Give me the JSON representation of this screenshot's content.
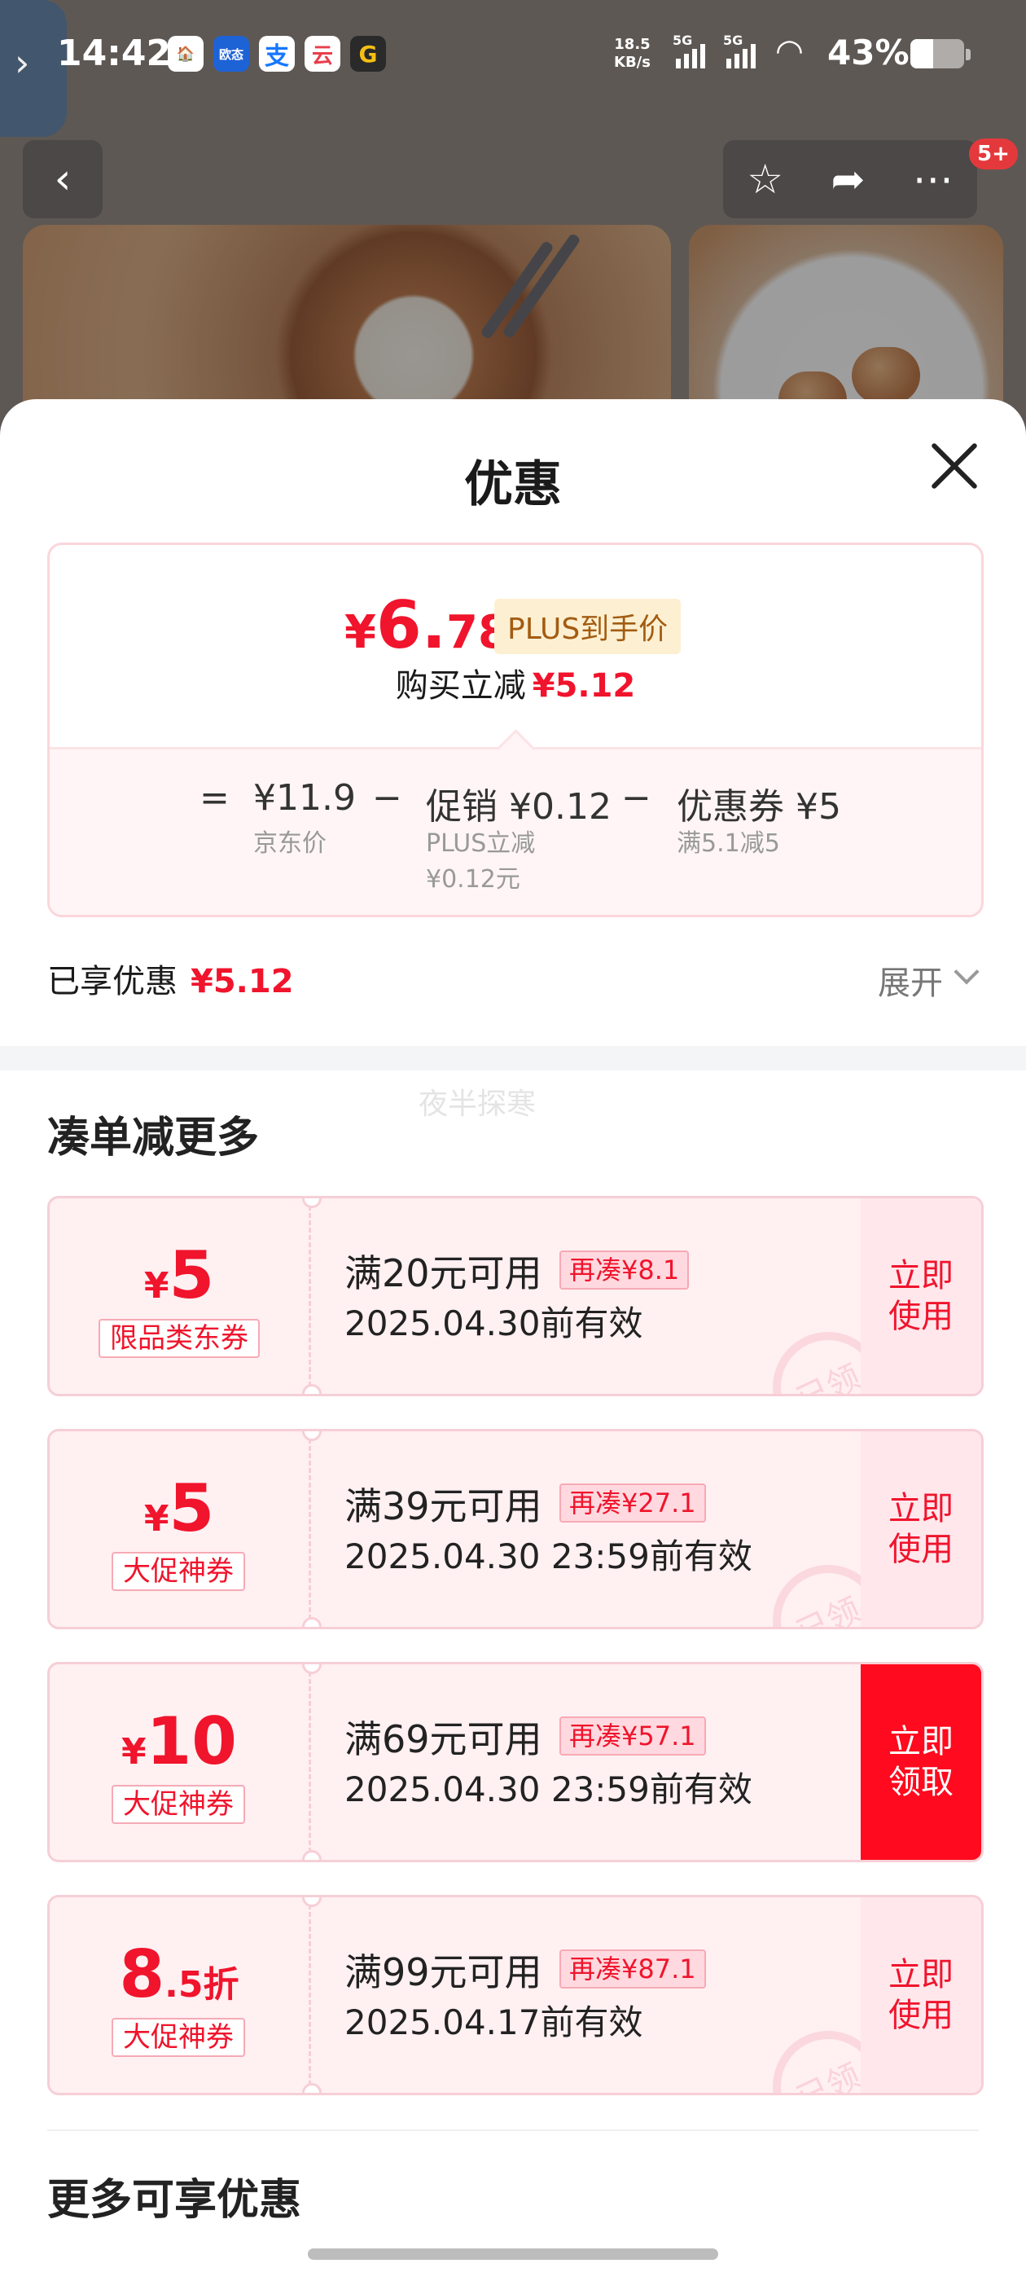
{
  "status_bar": {
    "time": "14:42",
    "app_icons": [
      {
        "label": "🏠",
        "color": "#3aa85a"
      },
      {
        "label": "欧态",
        "color": "#1e63d6"
      },
      {
        "label": "支",
        "color": "#1677ff"
      },
      {
        "label": "云",
        "color": "#e83e4b"
      },
      {
        "label": "G",
        "color": "#d9261c"
      }
    ],
    "net_speed_value": "18.5",
    "net_speed_unit": "KB/s",
    "signal1_label": "5G",
    "signal2_label": "5G",
    "battery": "43%",
    "battery_level": 0.43
  },
  "top_nav": {
    "badge": "5+"
  },
  "sheet": {
    "title": "优惠",
    "price_card": {
      "final_price_yen": "¥",
      "final_price_int": "6.",
      "final_price_dec": "78",
      "plus_tag": "PLUS到手价",
      "instant_label": "购买立减",
      "instant_amount": "¥5.12",
      "calc": {
        "equals": "=",
        "jd_price": "¥11.9",
        "jd_price_label": "京东价",
        "minus1": "−",
        "promo": "促销 ¥0.12",
        "promo_sub1": "PLUS立减",
        "promo_sub2": "¥0.12元",
        "minus2": "−",
        "coupon": "优惠券 ¥5",
        "coupon_sub": "满5.1减5"
      }
    },
    "enjoyed_label": "已享优惠",
    "enjoyed_amount": "¥5.12",
    "expand_label": "展开",
    "watermark": "夜半探寒",
    "section_more_deals": "凑单减更多",
    "coupons": [
      {
        "yen": "¥",
        "num": "5",
        "suffix": "",
        "type": "限品类东券",
        "cond": "满20元可用",
        "gap": "再凑¥8.1",
        "expiry": "2025.04.30前有效",
        "stamp": "已领",
        "action_line1": "立即",
        "action_line2": "使用"
      },
      {
        "yen": "¥",
        "num": "5",
        "suffix": "",
        "type": "大促神券",
        "cond": "满39元可用",
        "gap": "再凑¥27.1",
        "expiry": "2025.04.30 23:59前有效",
        "stamp": "已领",
        "action_line1": "立即",
        "action_line2": "使用"
      },
      {
        "yen": "¥",
        "num": "10",
        "suffix": "",
        "type": "大促神券",
        "cond": "满69元可用",
        "gap": "再凑¥57.1",
        "expiry": "2025.04.30 23:59前有效",
        "stamp": "",
        "action_line1": "立即",
        "action_line2": "领取"
      },
      {
        "yen": "",
        "num": "8",
        "suffix": ".5折",
        "type": "大促神券",
        "cond": "满99元可用",
        "gap": "再凑¥87.1",
        "expiry": "2025.04.17前有效",
        "stamp": "已领",
        "action_line1": "立即",
        "action_line2": "使用"
      }
    ],
    "section_more_benefits": "更多可享优惠"
  },
  "colors": {
    "accent_red": "#f0142c",
    "plus_gold": "#a35c12",
    "coupon_bg": "#fff0f2"
  }
}
